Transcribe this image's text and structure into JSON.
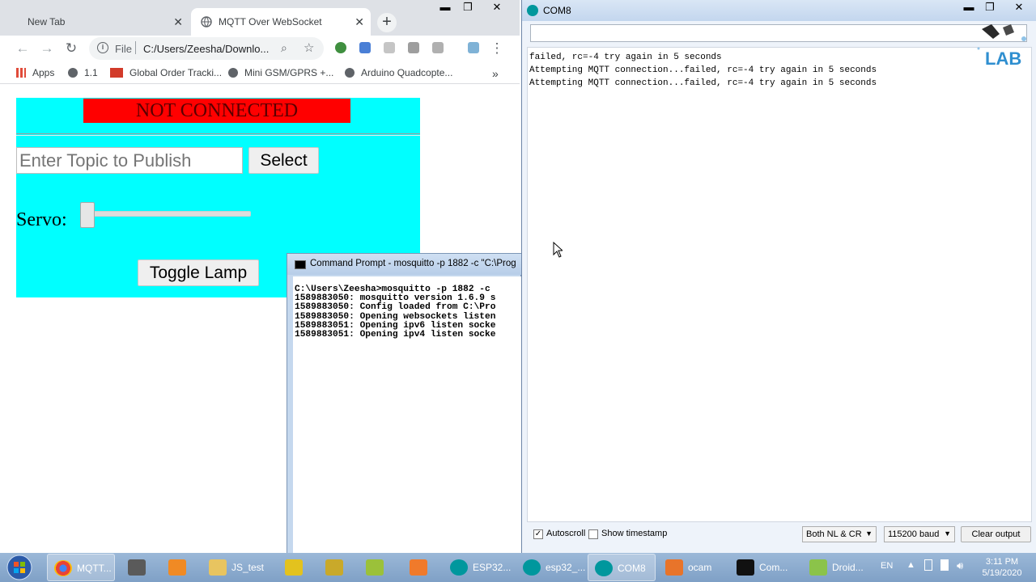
{
  "chrome": {
    "tabs": [
      {
        "label": "New Tab"
      },
      {
        "label": "MQTT Over WebSocket"
      }
    ],
    "toolbar": {
      "scheme": "File",
      "url": "C:/Users/Zeesha/Downlo..."
    },
    "bookmarks": [
      {
        "label": "Apps"
      },
      {
        "label": "1.1"
      },
      {
        "label": "Global Order Tracki..."
      },
      {
        "label": "Mini GSM/GPRS +..."
      },
      {
        "label": "Arduino Quadcopte..."
      }
    ],
    "page": {
      "status_text": "NOT CONNECTED",
      "topic_placeholder": "Enter Topic to Publish",
      "select_label": "Select",
      "servo_label": "Servo:",
      "servo_value": 0,
      "toggle_label": "Toggle Lamp",
      "colors": {
        "panel": "#00ffff",
        "status_bg": "#ff0000"
      }
    }
  },
  "cmd": {
    "title": "Command Prompt - mosquitto  -p 1882 -c \"C:\\Prog",
    "lines": [
      "C:\\Users\\Zeesha>mosquitto -p 1882 -c",
      "1589883050: mosquitto version 1.6.9 s",
      "1589883050: Config loaded from C:\\Pro",
      "1589883050: Opening websockets listen",
      "1589883051: Opening ipv6 listen socke",
      "1589883051: Opening ipv4 listen socke"
    ]
  },
  "serial": {
    "title": "COM8",
    "input_value": "",
    "logo_text": "LAB",
    "lines": [
      "failed, rc=-4 try again in 5 seconds",
      "Attempting MQTT connection...failed, rc=-4 try again in 5 seconds",
      "Attempting MQTT connection...failed, rc=-4 try again in 5 seconds"
    ],
    "autoscroll_label": "Autoscroll",
    "autoscroll_checked": true,
    "timestamp_label": "Show timestamp",
    "timestamp_checked": false,
    "line_ending": "Both NL & CR",
    "baud": "115200 baud",
    "clear_label": "Clear output"
  },
  "taskbar": {
    "items": [
      {
        "label": "MQTT..."
      },
      {
        "label": ""
      },
      {
        "label": ""
      },
      {
        "label": "JS_test"
      },
      {
        "label": ""
      },
      {
        "label": ""
      },
      {
        "label": ""
      },
      {
        "label": ""
      },
      {
        "label": "ESP32..."
      },
      {
        "label": "esp32_..."
      },
      {
        "label": "COM8"
      },
      {
        "label": "ocam"
      },
      {
        "label": "Com..."
      },
      {
        "label": "Droid..."
      }
    ],
    "lang": "EN",
    "time": "3:11 PM",
    "date": "5/19/2020"
  }
}
